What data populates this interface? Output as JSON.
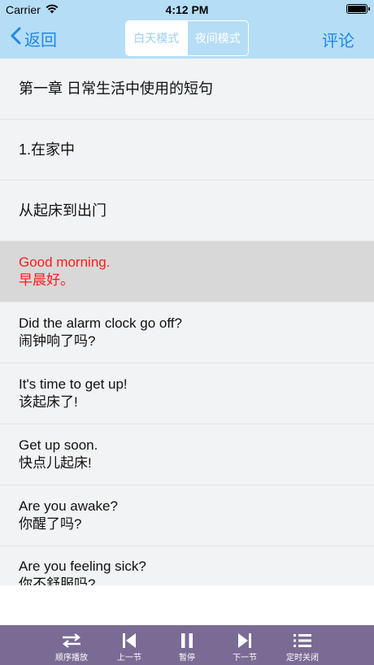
{
  "status_bar": {
    "carrier": "Carrier",
    "time": "4:12 PM"
  },
  "nav": {
    "back_label": "返回",
    "mode_day": "白天模式",
    "mode_night": "夜间模式",
    "comment_label": "评论"
  },
  "list": [
    {
      "line1": "第一章 日常生活中使用的短句",
      "line2": ""
    },
    {
      "line1": "1.在家中",
      "line2": ""
    },
    {
      "line1": "从起床到出门",
      "line2": ""
    },
    {
      "line1": "Good morning.",
      "line2": "早晨好。",
      "selected": true
    },
    {
      "line1": "Did the alarm clock go off?",
      "line2": "闹钟响了吗?"
    },
    {
      "line1": "It's time to get up!",
      "line2": "该起床了!"
    },
    {
      "line1": "Get up soon.",
      "line2": "快点儿起床!"
    },
    {
      "line1": "Are you awake?",
      "line2": "你醒了吗?"
    },
    {
      "line1": "Are you feeling sick?",
      "line2": "你不舒服吗?"
    }
  ],
  "toolbar": {
    "order_play": "顺序播放",
    "prev": "上一节",
    "pause": "暂停",
    "next": "下一节",
    "timer_off": "定时关闭"
  },
  "colors": {
    "nav_bg": "#b5ddf6",
    "accent": "#1e88e5",
    "selected_text": "#ff1a1a",
    "toolbar_bg": "#7a6b95"
  },
  "icons": {
    "back": "chevron-left-icon",
    "wifi": "wifi-icon",
    "battery": "battery-icon",
    "order_play": "shuffle-icon",
    "prev": "skip-back-icon",
    "pause": "pause-icon",
    "next": "skip-forward-icon",
    "timer_off": "list-icon"
  }
}
